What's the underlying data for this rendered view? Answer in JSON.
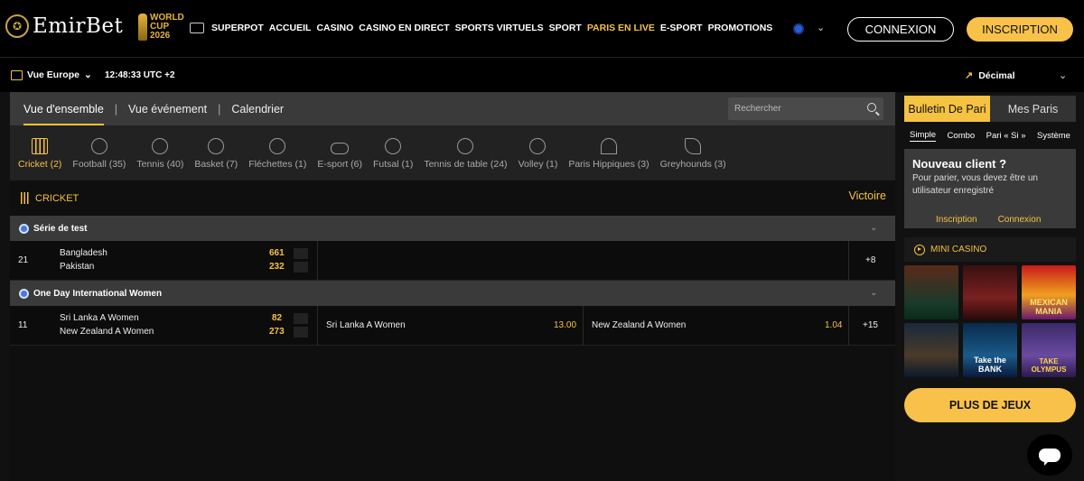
{
  "header": {
    "brand": "EmirBet",
    "world_cup": [
      "WORLD",
      "CUP",
      "2026"
    ],
    "nav": [
      "SUPERPOT",
      "ACCUEIL",
      "CASINO",
      "CASINO EN DIRECT",
      "SPORTS VIRTUELS",
      "SPORT",
      "PARIS EN LIVE",
      "E-SPORT",
      "PROMOTIONS"
    ],
    "active_nav": "PARIS EN LIVE",
    "login": "CONNEXION",
    "signup": "INSCRIPTION"
  },
  "subbar": {
    "view": "Vue Europe",
    "clock": "12:48:33 UTC +2",
    "odds_format": "Décimal"
  },
  "main": {
    "tabs": [
      "Vue d'ensemble",
      "Vue événement",
      "Calendrier"
    ],
    "search_placeholder": "Rechercher",
    "sports": [
      {
        "label": "Cricket (2)",
        "icon": "cricket-icon"
      },
      {
        "label": "Football (35)",
        "icon": "football-icon"
      },
      {
        "label": "Tennis (40)",
        "icon": "tennis-icon"
      },
      {
        "label": "Basket (7)",
        "icon": "basketball-icon"
      },
      {
        "label": "Fléchettes (1)",
        "icon": "darts-icon"
      },
      {
        "label": "E-sport (6)",
        "icon": "gamepad-icon"
      },
      {
        "label": "Futsal (1)",
        "icon": "futsal-icon"
      },
      {
        "label": "Tennis de table (24)",
        "icon": "table-tennis-icon"
      },
      {
        "label": "Volley (1)",
        "icon": "volleyball-icon"
      },
      {
        "label": "Paris Hippiques (3)",
        "icon": "horse-racing-icon"
      },
      {
        "label": "Greyhounds (3)",
        "icon": "greyhound-icon"
      }
    ],
    "category": "CRICKET",
    "category_right": "Victoire",
    "competitions": [
      {
        "name": "Série de test",
        "match": {
          "id": "21",
          "team1": "Bangladesh",
          "team2": "Pakistan",
          "score1": "661",
          "score2": "232",
          "more": "+8"
        }
      },
      {
        "name": "One Day International Women",
        "match": {
          "id": "11",
          "team1": "Sri Lanka A Women",
          "team2": "New Zealand A Women",
          "score1": "82",
          "score2": "273",
          "odd1_name": "Sri Lanka A Women",
          "odd1": "13.00",
          "odd2_name": "New Zealand A Women",
          "odd2": "1.04",
          "more": "+15"
        }
      }
    ]
  },
  "betslip": {
    "tabs": [
      "Bulletin De Pari",
      "Mes Paris"
    ],
    "types": [
      "Simple",
      "Combo",
      "Pari « Si »",
      "Système"
    ],
    "new_client_title": "Nouveau client ?",
    "new_client_text": "Pour parier, vous devez être un utilisateur enregistré",
    "link_signup": "Inscription",
    "link_login": "Connexion"
  },
  "casino": {
    "title": "MINI CASINO",
    "games": [
      "",
      "",
      "MEXICAN MANIA",
      "",
      "Take the BANK",
      "TAKE OLYMPUS"
    ],
    "more": "PLUS DE JEUX"
  },
  "colors": {
    "accent": "#f5c242",
    "bg": "#111111",
    "panel": "#3a3a3a"
  }
}
